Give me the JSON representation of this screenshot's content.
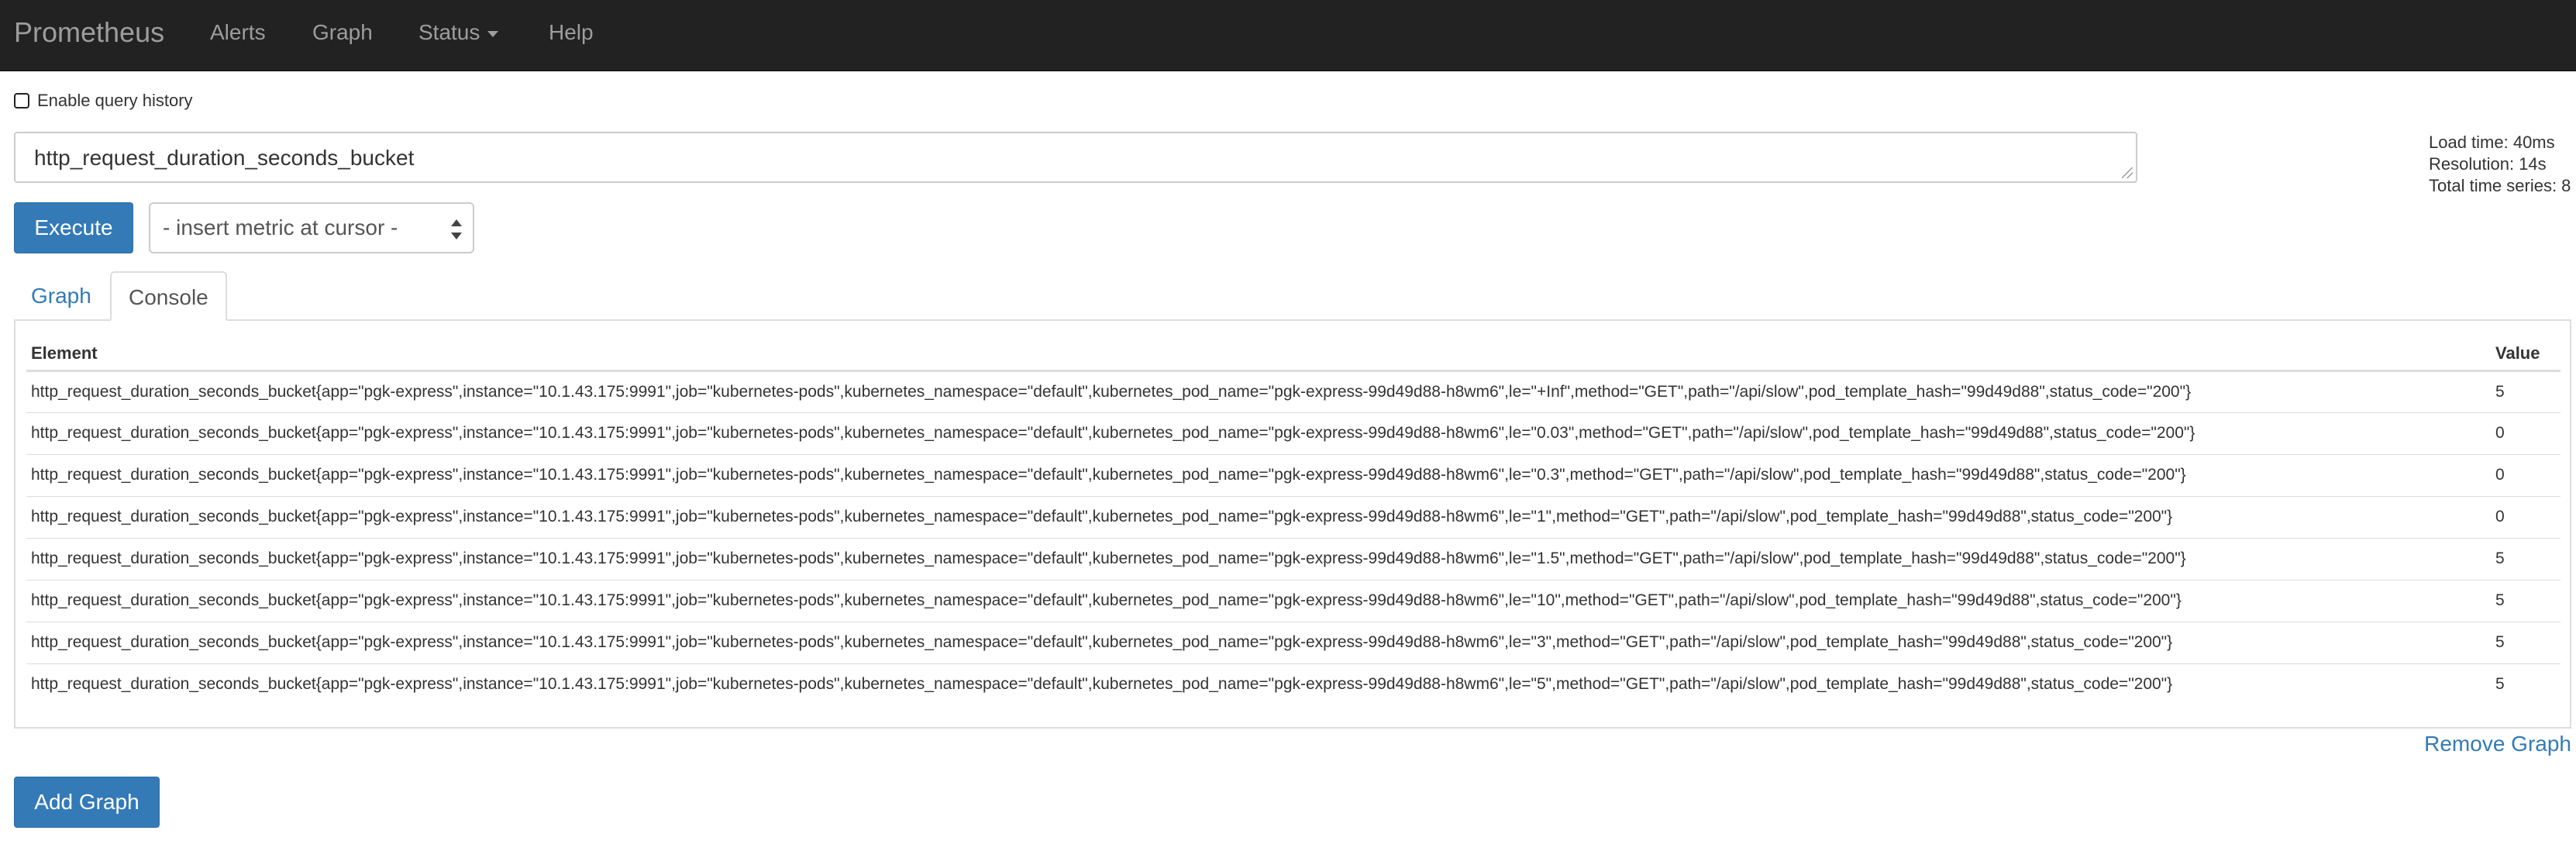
{
  "navbar": {
    "brand": "Prometheus",
    "items": [
      {
        "label": "Alerts"
      },
      {
        "label": "Graph"
      },
      {
        "label": "Status"
      },
      {
        "label": "Help"
      }
    ]
  },
  "history": {
    "label": "Enable query history",
    "checked": false
  },
  "query": {
    "expression": "http_request_duration_seconds_bucket"
  },
  "stats": {
    "load_time": "Load time: 40ms",
    "resolution": "Resolution: 14s",
    "total_series": "Total time series: 8"
  },
  "controls": {
    "execute_label": "Execute",
    "insert_metric": "- insert metric at cursor -"
  },
  "tabs": [
    {
      "label": "Graph",
      "active": false
    },
    {
      "label": "Console",
      "active": true
    }
  ],
  "table": {
    "headers": {
      "element": "Element",
      "value": "Value"
    },
    "rows": [
      {
        "element": "http_request_duration_seconds_bucket{app=\"pgk-express\",instance=\"10.1.43.175:9991\",job=\"kubernetes-pods\",kubernetes_namespace=\"default\",kubernetes_pod_name=\"pgk-express-99d49d88-h8wm6\",le=\"+Inf\",method=\"GET\",path=\"/api/slow\",pod_template_hash=\"99d49d88\",status_code=\"200\"}",
        "value": "5"
      },
      {
        "element": "http_request_duration_seconds_bucket{app=\"pgk-express\",instance=\"10.1.43.175:9991\",job=\"kubernetes-pods\",kubernetes_namespace=\"default\",kubernetes_pod_name=\"pgk-express-99d49d88-h8wm6\",le=\"0.03\",method=\"GET\",path=\"/api/slow\",pod_template_hash=\"99d49d88\",status_code=\"200\"}",
        "value": "0"
      },
      {
        "element": "http_request_duration_seconds_bucket{app=\"pgk-express\",instance=\"10.1.43.175:9991\",job=\"kubernetes-pods\",kubernetes_namespace=\"default\",kubernetes_pod_name=\"pgk-express-99d49d88-h8wm6\",le=\"0.3\",method=\"GET\",path=\"/api/slow\",pod_template_hash=\"99d49d88\",status_code=\"200\"}",
        "value": "0"
      },
      {
        "element": "http_request_duration_seconds_bucket{app=\"pgk-express\",instance=\"10.1.43.175:9991\",job=\"kubernetes-pods\",kubernetes_namespace=\"default\",kubernetes_pod_name=\"pgk-express-99d49d88-h8wm6\",le=\"1\",method=\"GET\",path=\"/api/slow\",pod_template_hash=\"99d49d88\",status_code=\"200\"}",
        "value": "0"
      },
      {
        "element": "http_request_duration_seconds_bucket{app=\"pgk-express\",instance=\"10.1.43.175:9991\",job=\"kubernetes-pods\",kubernetes_namespace=\"default\",kubernetes_pod_name=\"pgk-express-99d49d88-h8wm6\",le=\"1.5\",method=\"GET\",path=\"/api/slow\",pod_template_hash=\"99d49d88\",status_code=\"200\"}",
        "value": "5"
      },
      {
        "element": "http_request_duration_seconds_bucket{app=\"pgk-express\",instance=\"10.1.43.175:9991\",job=\"kubernetes-pods\",kubernetes_namespace=\"default\",kubernetes_pod_name=\"pgk-express-99d49d88-h8wm6\",le=\"10\",method=\"GET\",path=\"/api/slow\",pod_template_hash=\"99d49d88\",status_code=\"200\"}",
        "value": "5"
      },
      {
        "element": "http_request_duration_seconds_bucket{app=\"pgk-express\",instance=\"10.1.43.175:9991\",job=\"kubernetes-pods\",kubernetes_namespace=\"default\",kubernetes_pod_name=\"pgk-express-99d49d88-h8wm6\",le=\"3\",method=\"GET\",path=\"/api/slow\",pod_template_hash=\"99d49d88\",status_code=\"200\"}",
        "value": "5"
      },
      {
        "element": "http_request_duration_seconds_bucket{app=\"pgk-express\",instance=\"10.1.43.175:9991\",job=\"kubernetes-pods\",kubernetes_namespace=\"default\",kubernetes_pod_name=\"pgk-express-99d49d88-h8wm6\",le=\"5\",method=\"GET\",path=\"/api/slow\",pod_template_hash=\"99d49d88\",status_code=\"200\"}",
        "value": "5"
      }
    ]
  },
  "actions": {
    "remove_graph": "Remove Graph",
    "add_graph": "Add Graph"
  },
  "colors": {
    "navbar_bg": "#222222",
    "navbar_text": "#9d9d9d",
    "primary": "#337ab7",
    "border": "#dddddd"
  }
}
